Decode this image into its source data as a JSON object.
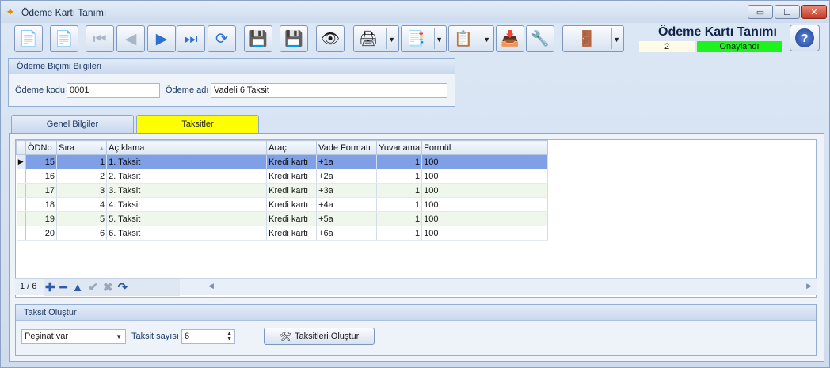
{
  "window": {
    "title": "Ödeme Kartı Tanımı",
    "controls": {
      "minimize": "▭",
      "maximize": "☐",
      "close": "✕"
    }
  },
  "toolbar": {
    "icons": [
      {
        "name": "new-document-icon",
        "glyph": "📄"
      },
      {
        "name": "delete-document-icon",
        "glyph": "📄"
      },
      {
        "name": "first-record-icon",
        "glyph": "⏮"
      },
      {
        "name": "previous-record-icon",
        "glyph": "◀"
      },
      {
        "name": "next-record-icon",
        "glyph": "▶"
      },
      {
        "name": "last-record-icon",
        "glyph": "⏭"
      },
      {
        "name": "refresh-icon",
        "glyph": "⟳"
      },
      {
        "name": "save-icon",
        "glyph": "💾"
      },
      {
        "name": "cancel-save-icon",
        "glyph": "💾"
      },
      {
        "name": "preview-icon",
        "glyph": "👁"
      },
      {
        "name": "print-icon",
        "glyph": "🖨"
      },
      {
        "name": "pdf-export-icon",
        "glyph": "📑"
      },
      {
        "name": "copy-icon",
        "glyph": "📋"
      },
      {
        "name": "import-icon",
        "glyph": "📥"
      },
      {
        "name": "tools-icon",
        "glyph": "🔧"
      },
      {
        "name": "exit-icon",
        "glyph": "🚪"
      }
    ]
  },
  "header": {
    "title": "Ödeme Kartı Tanımı",
    "record_no": "2",
    "status": "Onaylandı",
    "help_glyph": "?"
  },
  "payment_info": {
    "title": "Ödeme Biçimi Bilgileri",
    "code_label": "Ödeme kodu",
    "code_value": "0001",
    "name_label": "Ödeme adı",
    "name_value": "Vadeli 6 Taksit"
  },
  "tabs": [
    {
      "label": "Genel Bilgiler",
      "active": false
    },
    {
      "label": "Taksitler",
      "active": true
    }
  ],
  "grid": {
    "columns": [
      "ÖDNo",
      "Sıra",
      "Açıklama",
      "Araç",
      "Vade Formatı",
      "Yuvarlama",
      "Formül"
    ],
    "rows": [
      {
        "odno": "15",
        "sira": "1",
        "aciklama": "1. Taksit",
        "arac": "Kredi kartı",
        "vade": "+1a",
        "yuvarlama": "1",
        "formul": "100"
      },
      {
        "odno": "16",
        "sira": "2",
        "aciklama": "2. Taksit",
        "arac": "Kredi kartı",
        "vade": "+2a",
        "yuvarlama": "1",
        "formul": "100"
      },
      {
        "odno": "17",
        "sira": "3",
        "aciklama": "3. Taksit",
        "arac": "Kredi kartı",
        "vade": "+3a",
        "yuvarlama": "1",
        "formul": "100"
      },
      {
        "odno": "18",
        "sira": "4",
        "aciklama": "4. Taksit",
        "arac": "Kredi kartı",
        "vade": "+4a",
        "yuvarlama": "1",
        "formul": "100"
      },
      {
        "odno": "19",
        "sira": "5",
        "aciklama": "5. Taksit",
        "arac": "Kredi kartı",
        "vade": "+5a",
        "yuvarlama": "1",
        "formul": "100"
      },
      {
        "odno": "20",
        "sira": "6",
        "aciklama": "6. Taksit",
        "arac": "Kredi kartı",
        "vade": "+6a",
        "yuvarlama": "1",
        "formul": "100"
      }
    ],
    "nav_count": "1 / 6"
  },
  "installment_create": {
    "title": "Taksit Oluştur",
    "mode_value": "Peşinat var",
    "count_label": "Taksit sayısı",
    "count_value": "6",
    "create_button": "Taksitleri Oluştur"
  }
}
